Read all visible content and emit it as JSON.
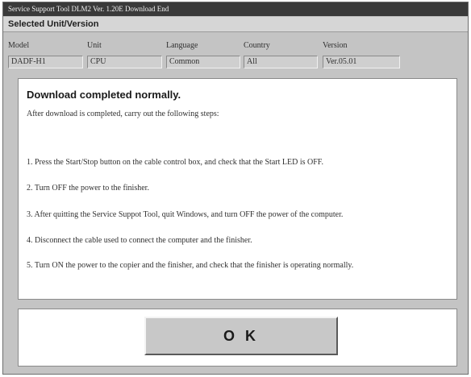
{
  "window": {
    "title": "Service Support Tool DLM2 Ver. 1.20E  Download End"
  },
  "selected_unit": {
    "header": "Selected Unit/Version",
    "columns": [
      {
        "label": "Model",
        "value": "DADF-H1"
      },
      {
        "label": "Unit",
        "value": "CPU"
      },
      {
        "label": "Language",
        "value": "Common"
      },
      {
        "label": "Country",
        "value": "All"
      },
      {
        "label": "Version",
        "value": "Ver.05.01"
      }
    ]
  },
  "message": {
    "title": "Download completed normally.",
    "intro": "After download is completed, carry out the following steps:",
    "steps": [
      "1. Press the Start/Stop button on the cable control box, and check that the Start LED is OFF.",
      "2. Turn OFF the power to the finisher.",
      "3. After quitting the Service Suppot Tool, quit Windows, and turn OFF the power of the computer.",
      "4. Disconnect the cable used to connect the computer and the finisher.",
      "5. Turn ON the power to the copier and the finisher, and check that the finisher is operating normally."
    ]
  },
  "buttons": {
    "ok_label": "O K"
  }
}
